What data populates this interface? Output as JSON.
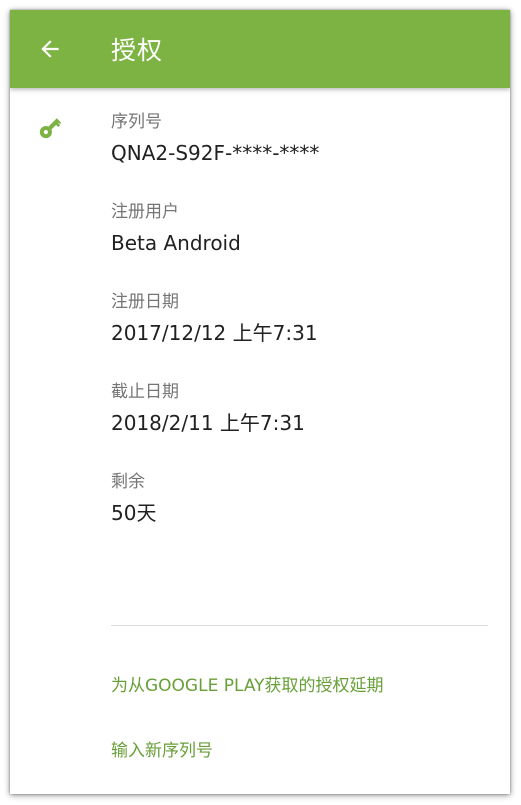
{
  "appbar": {
    "title": "授权",
    "back_icon": "arrow-back-icon",
    "color": "#7cb342"
  },
  "license": {
    "icon": "key-icon",
    "icon_color": "#7cb342",
    "fields": [
      {
        "label": "序列号",
        "value": "QNA2-S92F-****-****"
      },
      {
        "label": "注册用户",
        "value": "Beta Android"
      },
      {
        "label": "注册日期",
        "value": "2017/12/12 上午7:31"
      },
      {
        "label": "截止日期",
        "value": "2018/2/11 上午7:31"
      },
      {
        "label": "剩余",
        "value": "50天"
      }
    ]
  },
  "actions": {
    "extend_label": "为从GOOGLE PLAY获取的授权延期",
    "new_serial_label": "输入新序列号",
    "link_color": "#689f38"
  }
}
